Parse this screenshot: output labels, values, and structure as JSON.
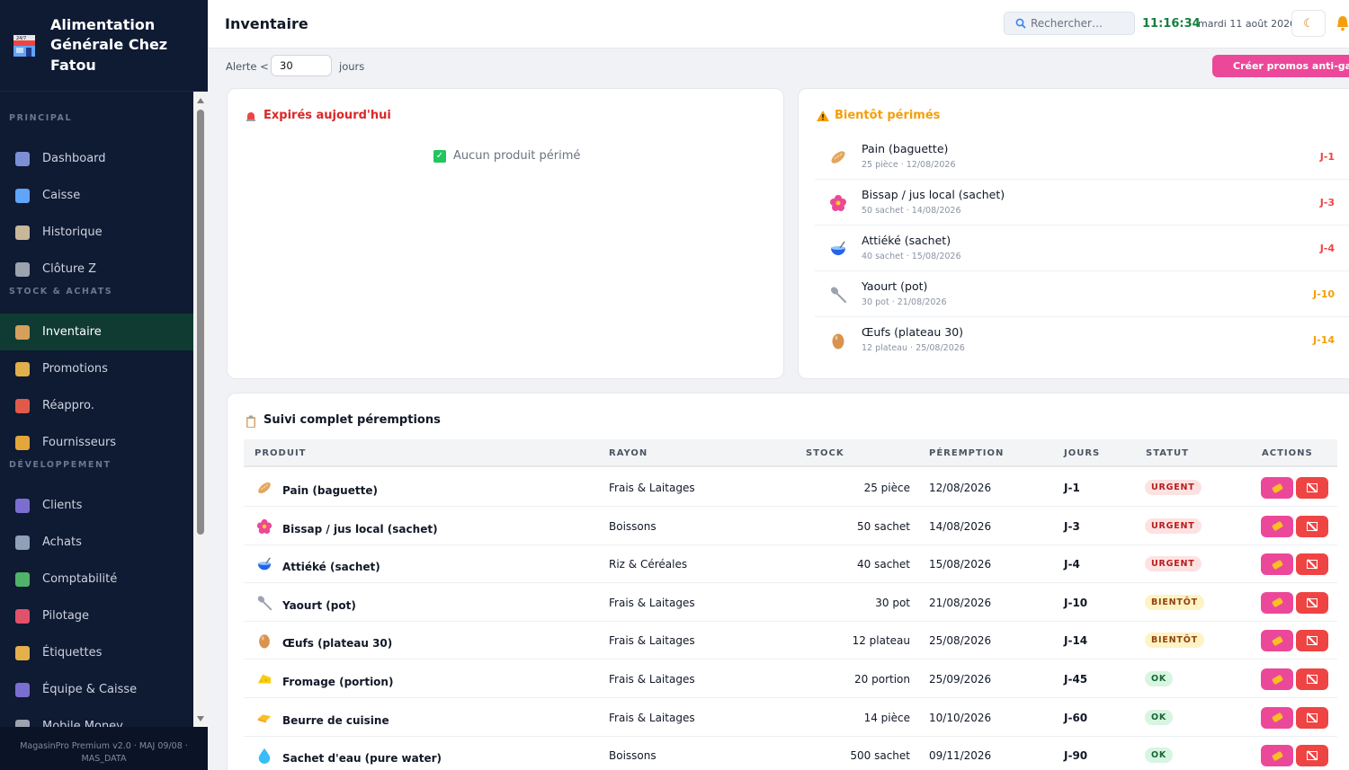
{
  "app": {
    "name": "Alimentation Générale Chez Fatou"
  },
  "sidebar": {
    "sections": [
      "PRINCIPAL",
      "STOCK & ACHATS",
      "DÉVELOPPEMENT"
    ],
    "items": [
      {
        "label": "Dashboard",
        "icon": "chart-icon",
        "color": "#7c8fd6"
      },
      {
        "label": "Caisse",
        "icon": "card-icon",
        "color": "#60a5fa"
      },
      {
        "label": "Historique",
        "icon": "scroll-icon",
        "color": "#c7b79b"
      },
      {
        "label": "Clôture Z",
        "icon": "receipt-icon",
        "color": "#9ca3af"
      },
      {
        "label": "Inventaire",
        "icon": "box-icon",
        "color": "#d6a05c",
        "active": true
      },
      {
        "label": "Promotions",
        "icon": "tag-icon",
        "color": "#e0b04a"
      },
      {
        "label": "Réappro.",
        "icon": "truck-icon",
        "color": "#e05a4a"
      },
      {
        "label": "Fournisseurs",
        "icon": "handshake-icon",
        "color": "#e3a63b"
      },
      {
        "label": "Clients",
        "icon": "users-icon",
        "color": "#7a6fd0"
      },
      {
        "label": "Achats",
        "icon": "cart-icon",
        "color": "#8fa0b8"
      },
      {
        "label": "Comptabilité",
        "icon": "books-icon",
        "color": "#4fb36a"
      },
      {
        "label": "Pilotage",
        "icon": "target-icon",
        "color": "#e0526a"
      },
      {
        "label": "Étiquettes",
        "icon": "label-icon",
        "color": "#e3b04a"
      },
      {
        "label": "Équipe & Caisse",
        "icon": "team-icon",
        "color": "#7a6fd0"
      },
      {
        "label": "Mobile Money",
        "icon": "phone-icon",
        "color": "#9ca3af"
      }
    ],
    "footer": "MagasinPro Premium v2.0 · MAJ 09/08 · MAS_DATA"
  },
  "topbar": {
    "title": "Inventaire",
    "search_placeholder": "Rechercher…",
    "clock": "11:16:34",
    "date": "mardi 11 août 2026"
  },
  "alert": {
    "prefix": "Alerte <",
    "value": "30",
    "unit": "jours"
  },
  "promo_button": "Créer promos anti-gaspi",
  "expired": {
    "title": "Expirés aujourd'hui",
    "empty": "Aucun produit périmé"
  },
  "soon": {
    "title": "Bientôt périmés",
    "items": [
      {
        "name": "Pain (baguette)",
        "sub": "25 pièce · 12/08/2026",
        "days": "J-1",
        "color": "#ef4444",
        "icon": "bread-icon"
      },
      {
        "name": "Bissap / jus local (sachet)",
        "sub": "50 sachet · 14/08/2026",
        "days": "J-3",
        "color": "#ef4444",
        "icon": "hibiscus-icon"
      },
      {
        "name": "Attiéké (sachet)",
        "sub": "40 sachet · 15/08/2026",
        "days": "J-4",
        "color": "#ef4444",
        "icon": "bowl-icon"
      },
      {
        "name": "Yaourt (pot)",
        "sub": "30 pot · 21/08/2026",
        "days": "J-10",
        "color": "#f59e0b",
        "icon": "spoon-icon"
      },
      {
        "name": "Œufs (plateau 30)",
        "sub": "12 plateau · 25/08/2026",
        "days": "J-14",
        "color": "#f59e0b",
        "icon": "egg-icon"
      }
    ]
  },
  "table": {
    "title": "Suivi complet péremptions",
    "headers": [
      "PRODUIT",
      "RAYON",
      "STOCK",
      "PÉREMPTION",
      "JOURS",
      "STATUT",
      "ACTIONS"
    ],
    "rows": [
      {
        "name": "Pain (baguette)",
        "rayon": "Frais & Laitages",
        "stock": "25 pièce",
        "date": "12/08/2026",
        "days": "J-1",
        "status": "URGENT",
        "icon": "bread-icon"
      },
      {
        "name": "Bissap / jus local (sachet)",
        "rayon": "Boissons",
        "stock": "50 sachet",
        "date": "14/08/2026",
        "days": "J-3",
        "status": "URGENT",
        "icon": "hibiscus-icon"
      },
      {
        "name": "Attiéké (sachet)",
        "rayon": "Riz & Céréales",
        "stock": "40 sachet",
        "date": "15/08/2026",
        "days": "J-4",
        "status": "URGENT",
        "icon": "bowl-icon"
      },
      {
        "name": "Yaourt (pot)",
        "rayon": "Frais & Laitages",
        "stock": "30 pot",
        "date": "21/08/2026",
        "days": "J-10",
        "status": "BIENTÔT",
        "icon": "spoon-icon"
      },
      {
        "name": "Œufs (plateau 30)",
        "rayon": "Frais & Laitages",
        "stock": "12 plateau",
        "date": "25/08/2026",
        "days": "J-14",
        "status": "BIENTÔT",
        "icon": "egg-icon"
      },
      {
        "name": "Fromage (portion)",
        "rayon": "Frais & Laitages",
        "stock": "20 portion",
        "date": "25/09/2026",
        "days": "J-45",
        "status": "OK",
        "icon": "cheese-icon"
      },
      {
        "name": "Beurre de cuisine",
        "rayon": "Frais & Laitages",
        "stock": "14 pièce",
        "date": "10/10/2026",
        "days": "J-60",
        "status": "OK",
        "icon": "butter-icon"
      },
      {
        "name": "Sachet d'eau (pure water)",
        "rayon": "Boissons",
        "stock": "500 sachet",
        "date": "09/11/2026",
        "days": "J-90",
        "status": "OK",
        "icon": "droplet-icon"
      }
    ]
  }
}
